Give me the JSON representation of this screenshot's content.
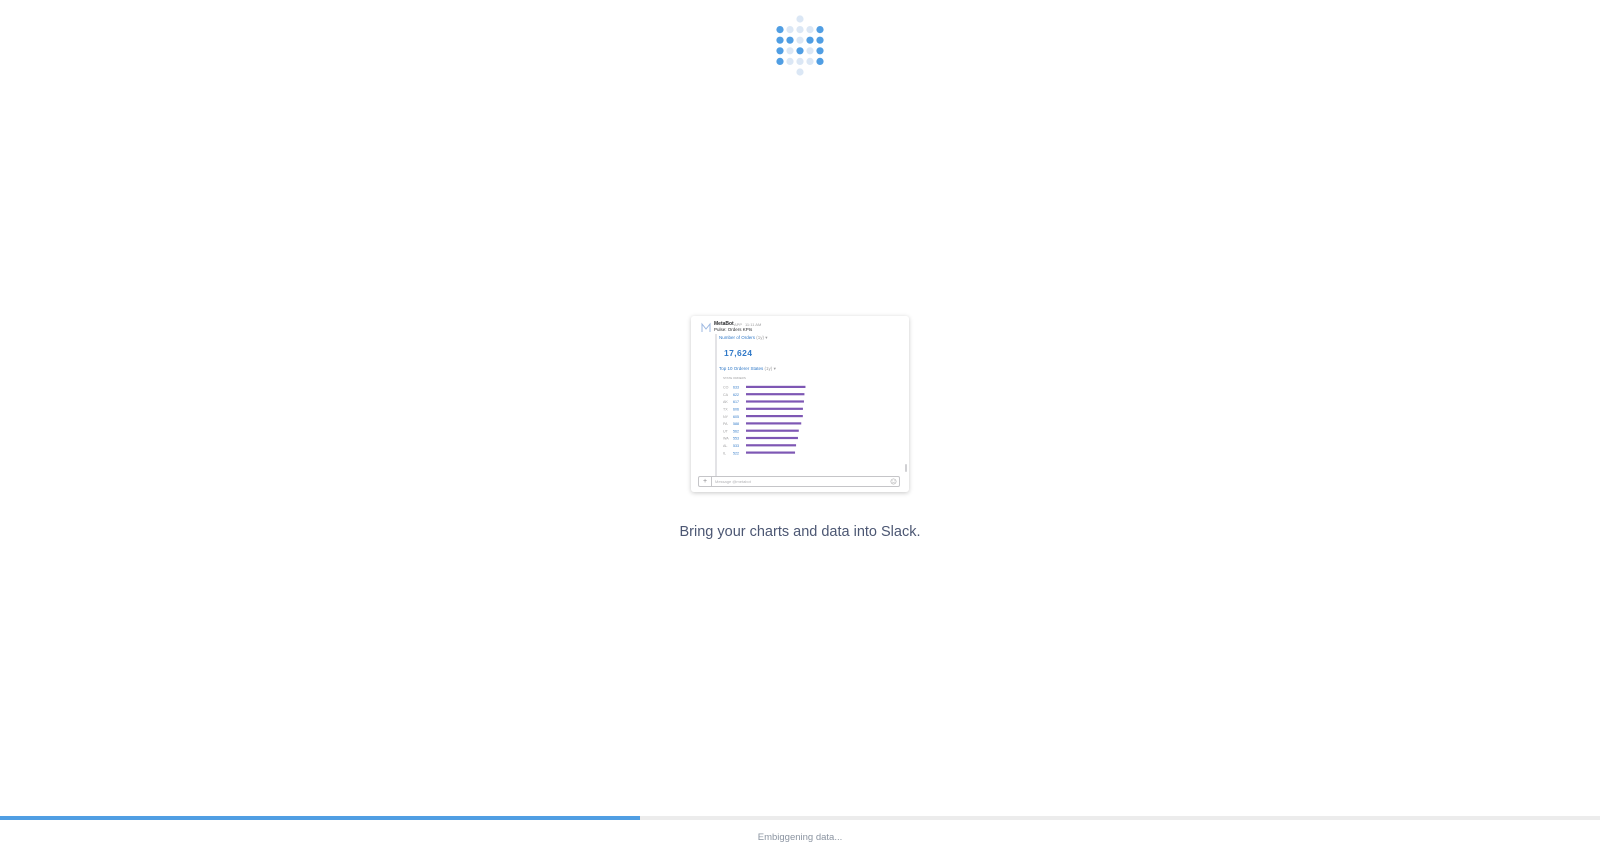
{
  "logo": {
    "name": "metabase-logo-icon",
    "dots": [
      {
        "c": 2,
        "r": 0,
        "s": "light"
      },
      {
        "c": 0,
        "r": 1,
        "s": "dark"
      },
      {
        "c": 1,
        "r": 1,
        "s": "light"
      },
      {
        "c": 2,
        "r": 1,
        "s": "light"
      },
      {
        "c": 3,
        "r": 1,
        "s": "light"
      },
      {
        "c": 4,
        "r": 1,
        "s": "dark"
      },
      {
        "c": 0,
        "r": 2,
        "s": "dark"
      },
      {
        "c": 1,
        "r": 2,
        "s": "dark"
      },
      {
        "c": 2,
        "r": 2,
        "s": "light"
      },
      {
        "c": 3,
        "r": 2,
        "s": "dark"
      },
      {
        "c": 4,
        "r": 2,
        "s": "dark"
      },
      {
        "c": 0,
        "r": 3,
        "s": "dark"
      },
      {
        "c": 1,
        "r": 3,
        "s": "light"
      },
      {
        "c": 2,
        "r": 3,
        "s": "dark"
      },
      {
        "c": 3,
        "r": 3,
        "s": "light"
      },
      {
        "c": 4,
        "r": 3,
        "s": "dark"
      },
      {
        "c": 0,
        "r": 4,
        "s": "dark"
      },
      {
        "c": 1,
        "r": 4,
        "s": "light"
      },
      {
        "c": 2,
        "r": 4,
        "s": "light"
      },
      {
        "c": 3,
        "r": 4,
        "s": "light"
      },
      {
        "c": 4,
        "r": 4,
        "s": "dark"
      },
      {
        "c": 2,
        "r": 5,
        "s": "light"
      }
    ],
    "colors": {
      "dark": "#509ee3",
      "light": "#dbe7f5"
    }
  },
  "preview": {
    "bot_name": "MetaBot",
    "bot_app": "APP",
    "bot_time": "11:11 AM",
    "pulse_title": "Pulse: Orders KPIs",
    "card1": {
      "title": "Number of Orders",
      "title_extra": "(1y)",
      "caret": "▾",
      "value": "17,624"
    },
    "card2": {
      "title": "Top 10 Orderer States",
      "title_extra": "(1y)",
      "caret": "▾"
    },
    "composer_plus": "+",
    "composer_placeholder": "Message @metabot",
    "icons": {
      "avatar": "metabase-m-icon",
      "emoji": "smiley-icon"
    },
    "bar_color": "#7e57b4",
    "value_color": "#3079c8",
    "label_color": "#a0a0a2"
  },
  "chart_data": {
    "type": "bar",
    "orientation": "horizontal",
    "column_labels": [
      "STATE",
      "ORDERS"
    ],
    "categories": [
      "CO",
      "CA",
      "AK",
      "TX",
      "NY",
      "PA",
      "UT",
      "WA",
      "AL",
      "IL"
    ],
    "values": [
      633,
      622,
      617,
      606,
      605,
      588,
      562,
      553,
      533,
      522
    ],
    "xlim": [
      0,
      660
    ]
  },
  "tagline": "Bring your charts and data into Slack.",
  "progress": {
    "fraction": 0.4,
    "color": "#509ee3"
  },
  "status": "Embiggening data..."
}
